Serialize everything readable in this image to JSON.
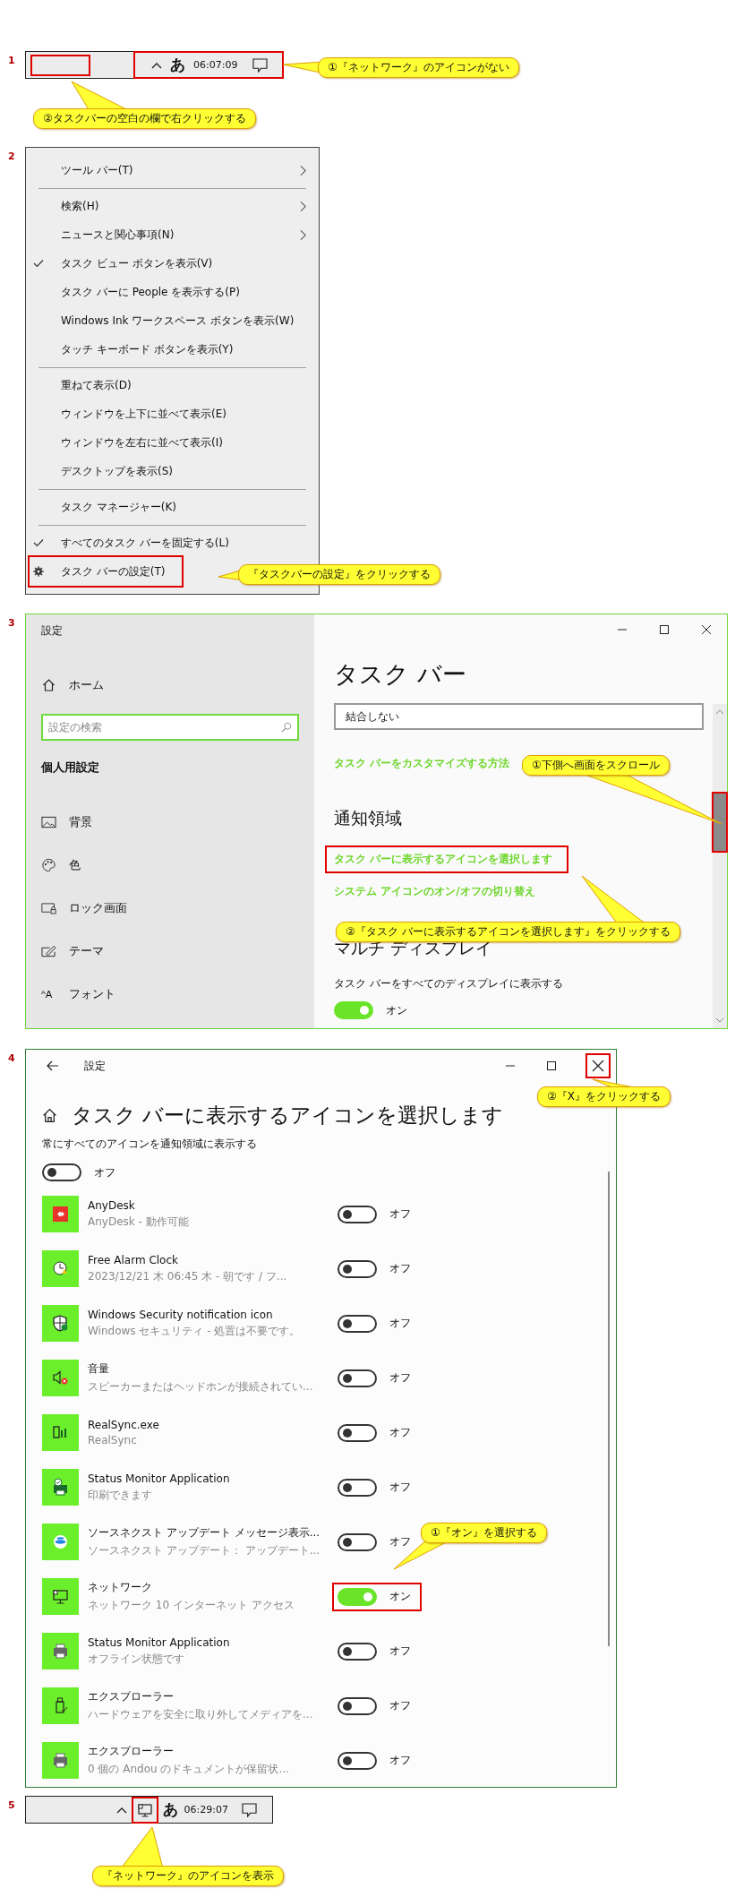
{
  "step1": {
    "number": "1",
    "taskbar": {
      "empty_area_highlighted": true,
      "tray_highlighted": true,
      "ime": "あ",
      "time": "06:07:09"
    },
    "callouts": [
      {
        "text": "①『ネットワーク』のアイコンがない"
      },
      {
        "text": "②タスクバーの空白の欄で右クリックする"
      }
    ]
  },
  "step2": {
    "number": "2",
    "menu": [
      {
        "kind": "item",
        "label": "ツール バー(T)",
        "checked": false,
        "submenu": true,
        "highlighted": false
      },
      {
        "kind": "separator"
      },
      {
        "kind": "item",
        "label": "検索(H)",
        "checked": false,
        "submenu": true,
        "highlighted": false
      },
      {
        "kind": "item",
        "label": "ニュースと関心事項(N)",
        "checked": false,
        "submenu": true,
        "highlighted": false
      },
      {
        "kind": "item",
        "label": "タスク ビュー ボタンを表示(V)",
        "checked": true,
        "submenu": false,
        "highlighted": false
      },
      {
        "kind": "item",
        "label": "タスク バーに People を表示する(P)",
        "checked": false,
        "submenu": false,
        "highlighted": false
      },
      {
        "kind": "item",
        "label": "Windows Ink ワークスペース ボタンを表示(W)",
        "checked": false,
        "submenu": false,
        "highlighted": false
      },
      {
        "kind": "item",
        "label": "タッチ キーボード ボタンを表示(Y)",
        "checked": false,
        "submenu": false,
        "highlighted": false
      },
      {
        "kind": "separator"
      },
      {
        "kind": "item",
        "label": "重ねて表示(D)",
        "checked": false,
        "submenu": false,
        "highlighted": false
      },
      {
        "kind": "item",
        "label": "ウィンドウを上下に並べて表示(E)",
        "checked": false,
        "submenu": false,
        "highlighted": false
      },
      {
        "kind": "item",
        "label": "ウィンドウを左右に並べて表示(I)",
        "checked": false,
        "submenu": false,
        "highlighted": false
      },
      {
        "kind": "item",
        "label": "デスクトップを表示(S)",
        "checked": false,
        "submenu": false,
        "highlighted": false
      },
      {
        "kind": "separator"
      },
      {
        "kind": "item",
        "label": "タスク マネージャー(K)",
        "checked": false,
        "submenu": false,
        "highlighted": false
      },
      {
        "kind": "separator"
      },
      {
        "kind": "item",
        "label": "すべてのタスク バーを固定する(L)",
        "checked": true,
        "submenu": false,
        "highlighted": false
      },
      {
        "kind": "settings",
        "label": "タスク バーの設定(T)",
        "highlighted": true
      }
    ],
    "callouts": [
      {
        "text": "『タスクバーの設定』をクリックする"
      }
    ]
  },
  "step3": {
    "number": "3",
    "window": {
      "title": "設定"
    },
    "sidebar": {
      "home": "ホーム",
      "search": {
        "placeholder": "設定の検索"
      },
      "section": "個人用設定",
      "items": [
        {
          "kind": "image",
          "label": "背景"
        },
        {
          "kind": "palette",
          "label": "色"
        },
        {
          "kind": "lock",
          "label": "ロック画面"
        },
        {
          "kind": "theme",
          "label": "テーマ"
        },
        {
          "kind": "glyph",
          "glyph": "ᴬA",
          "label": "フォント"
        }
      ]
    },
    "main": {
      "title": "タスク バー",
      "dropdown": {
        "value": "結合しない"
      },
      "customize_link": "タスク バーをカスタマイズする方法",
      "notification_heading": "通知領域",
      "notification_links": [
        {
          "text": "タスク バーに表示するアイコンを選択します",
          "highlighted": true
        },
        {
          "text": "システム アイコンのオン/オフの切り替え",
          "highlighted": false
        }
      ],
      "multi_heading": "マルチ ディスプレイ",
      "multi_setting": {
        "label": "タスク バーをすべてのディスプレイに表示する",
        "on": true,
        "state_label": "オン"
      }
    },
    "scrollbar_highlighted": true,
    "callouts": [
      {
        "text": "①下側へ画面をスクロール"
      },
      {
        "text": "②『タスク バーに表示するアイコンを選択します』をクリックする"
      }
    ]
  },
  "step4": {
    "number": "4",
    "window": {
      "title": "設定",
      "close_highlighted": true
    },
    "title": "タスク バーに表示するアイコンを選択します",
    "always_show": {
      "label": "常にすべてのアイコンを通知領域に表示する",
      "on": false,
      "state_label": "オフ"
    },
    "apps": [
      {
        "kind": "remote",
        "name": "AnyDesk",
        "detail": "AnyDesk - 動作可能",
        "on": false,
        "state_label": "オフ",
        "highlighted": false
      },
      {
        "kind": "clock",
        "name": "Free Alarm Clock",
        "detail": "2023/12/21 木 06:45 木 - 朝です / フ...",
        "on": false,
        "state_label": "オフ",
        "highlighted": false
      },
      {
        "kind": "shield",
        "name": "Windows Security notification icon",
        "detail": "Windows セキュリティ - 処置は不要です。",
        "on": false,
        "state_label": "オフ",
        "highlighted": false
      },
      {
        "kind": "speaker",
        "name": "音量",
        "detail": "スピーカーまたはヘッドホンが接続されてい...",
        "on": false,
        "state_label": "オフ",
        "highlighted": false
      },
      {
        "kind": "sync",
        "name": "RealSync.exe",
        "detail": "RealSync",
        "on": false,
        "state_label": "オフ",
        "highlighted": false
      },
      {
        "kind": "printer-check",
        "name": "Status Monitor Application",
        "detail": "印刷できます",
        "on": false,
        "state_label": "オフ",
        "highlighted": false
      },
      {
        "kind": "globe",
        "name": "ソースネクスト アップデート メッセージ表示...",
        "detail": "ソースネクスト アップデート： アップデート...",
        "on": false,
        "state_label": "オフ",
        "highlighted": false
      },
      {
        "kind": "monitor",
        "name": "ネットワーク",
        "detail": "ネットワーク  10 インターネット アクセス",
        "on": true,
        "state_label": "オン",
        "highlighted": true
      },
      {
        "kind": "printer",
        "name": "Status Monitor Application",
        "detail": "オフライン状態です",
        "on": false,
        "state_label": "オフ",
        "highlighted": false
      },
      {
        "kind": "usb",
        "name": "エクスプローラー",
        "detail": "ハードウェアを安全に取り外してメディアを...",
        "on": false,
        "state_label": "オフ",
        "highlighted": false
      },
      {
        "kind": "printer",
        "name": "エクスプローラー",
        "detail": "0 個の Andou のドキュメントが保留状...",
        "on": false,
        "state_label": "オフ",
        "highlighted": false
      }
    ],
    "callouts": [
      {
        "text": "②『X』をクリックする"
      },
      {
        "text": "①『オン』を選択する"
      }
    ]
  },
  "step5": {
    "number": "5",
    "taskbar": {
      "network_highlighted": true,
      "ime": "あ",
      "time": "06:29:07"
    },
    "callouts": [
      {
        "text": "『ネットワーク』のアイコンを表示"
      }
    ]
  }
}
